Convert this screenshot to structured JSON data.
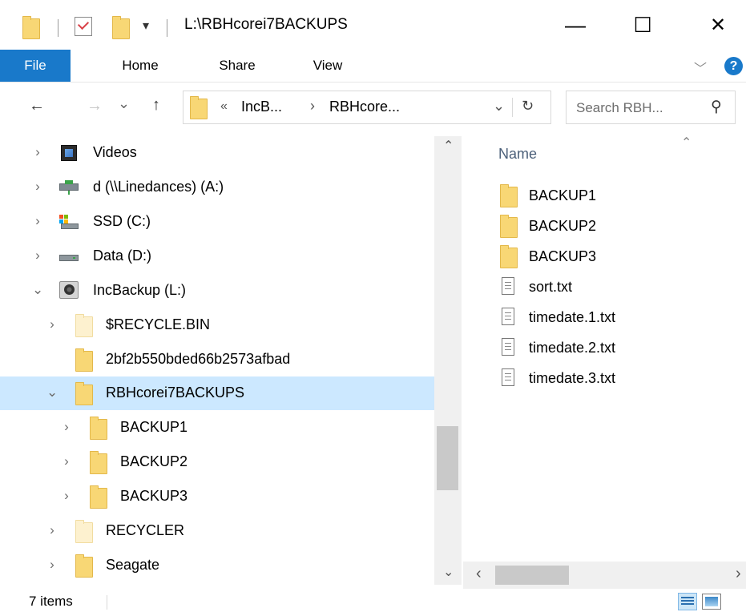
{
  "window": {
    "title": "L:\\RBHcorei7BACKUPS",
    "minimize_glyph": "—",
    "maximize_glyph": "☐",
    "close_glyph": "✕",
    "quick_access_dropdown": "▾"
  },
  "ribbon": {
    "tabs": [
      "File",
      "Home",
      "Share",
      "View"
    ],
    "expand_glyph": "﹀",
    "help_glyph": "?"
  },
  "nav": {
    "back": "←",
    "forward": "→",
    "recent": "⌄",
    "up": "↑",
    "breadcrumb_overflow": "«",
    "breadcrumb": [
      "IncB...",
      "RBHcore..."
    ],
    "breadcrumb_sep": "›",
    "address_dropdown": "⌄",
    "refresh": "↻",
    "search_placeholder": "Search RBH...",
    "search_icon": "⚲"
  },
  "tree": [
    {
      "label": "Videos",
      "icon": "videos-icon",
      "expander": "›"
    },
    {
      "label": "d (\\\\Linedances) (A:)",
      "icon": "network-drive-icon",
      "expander": "›"
    },
    {
      "label": "SSD (C:)",
      "icon": "system-drive-icon",
      "expander": "›"
    },
    {
      "label": "Data (D:)",
      "icon": "drive-icon",
      "expander": "›"
    },
    {
      "label": "IncBackup (L:)",
      "icon": "backup-drive-icon",
      "expander": "⌄"
    },
    {
      "label": "$RECYCLE.BIN",
      "icon": "hidden-folder-icon",
      "expander": "›"
    },
    {
      "label": "2bf2b550bded66b2573afbad",
      "icon": "folder-icon",
      "expander": ""
    },
    {
      "label": "RBHcorei7BACKUPS",
      "icon": "folder-icon",
      "expander": "⌄",
      "selected": true
    },
    {
      "label": "BACKUP1",
      "icon": "folder-icon",
      "expander": "›"
    },
    {
      "label": "BACKUP2",
      "icon": "folder-icon",
      "expander": "›"
    },
    {
      "label": "BACKUP3",
      "icon": "folder-icon",
      "expander": "›"
    },
    {
      "label": "RECYCLER",
      "icon": "hidden-folder-icon",
      "expander": "›"
    },
    {
      "label": "Seagate",
      "icon": "folder-icon",
      "expander": "›"
    }
  ],
  "scroll": {
    "up": "⌃",
    "down": "⌄",
    "left": "‹",
    "right": "›"
  },
  "content": {
    "column_header": "Name",
    "sort_glyph": "⌃",
    "files": [
      {
        "name": "BACKUP1",
        "type": "folder"
      },
      {
        "name": "BACKUP2",
        "type": "folder"
      },
      {
        "name": "BACKUP3",
        "type": "folder"
      },
      {
        "name": "sort.txt",
        "type": "text"
      },
      {
        "name": "timedate.1.txt",
        "type": "text"
      },
      {
        "name": "timedate.2.txt",
        "type": "text"
      },
      {
        "name": "timedate.3.txt",
        "type": "text"
      }
    ]
  },
  "status": {
    "count": "7 items"
  },
  "colors": {
    "accent": "#1979ca",
    "selection": "#cce8ff",
    "folder": "#f8d775"
  }
}
